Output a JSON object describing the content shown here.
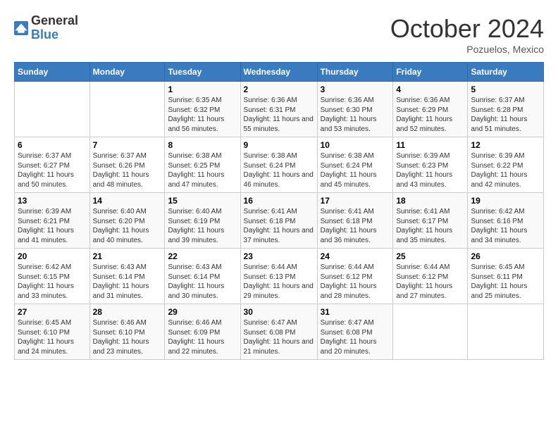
{
  "logo": {
    "general": "General",
    "blue": "Blue"
  },
  "header": {
    "month": "October 2024",
    "location": "Pozuelos, Mexico"
  },
  "days_of_week": [
    "Sunday",
    "Monday",
    "Tuesday",
    "Wednesday",
    "Thursday",
    "Friday",
    "Saturday"
  ],
  "weeks": [
    [
      {
        "day": "",
        "info": ""
      },
      {
        "day": "",
        "info": ""
      },
      {
        "day": "1",
        "sunrise": "6:35 AM",
        "sunset": "6:32 PM",
        "daylight": "11 hours and 56 minutes."
      },
      {
        "day": "2",
        "sunrise": "6:36 AM",
        "sunset": "6:31 PM",
        "daylight": "11 hours and 55 minutes."
      },
      {
        "day": "3",
        "sunrise": "6:36 AM",
        "sunset": "6:30 PM",
        "daylight": "11 hours and 53 minutes."
      },
      {
        "day": "4",
        "sunrise": "6:36 AM",
        "sunset": "6:29 PM",
        "daylight": "11 hours and 52 minutes."
      },
      {
        "day": "5",
        "sunrise": "6:37 AM",
        "sunset": "6:28 PM",
        "daylight": "11 hours and 51 minutes."
      }
    ],
    [
      {
        "day": "6",
        "sunrise": "6:37 AM",
        "sunset": "6:27 PM",
        "daylight": "11 hours and 50 minutes."
      },
      {
        "day": "7",
        "sunrise": "6:37 AM",
        "sunset": "6:26 PM",
        "daylight": "11 hours and 48 minutes."
      },
      {
        "day": "8",
        "sunrise": "6:38 AM",
        "sunset": "6:25 PM",
        "daylight": "11 hours and 47 minutes."
      },
      {
        "day": "9",
        "sunrise": "6:38 AM",
        "sunset": "6:24 PM",
        "daylight": "11 hours and 46 minutes."
      },
      {
        "day": "10",
        "sunrise": "6:38 AM",
        "sunset": "6:24 PM",
        "daylight": "11 hours and 45 minutes."
      },
      {
        "day": "11",
        "sunrise": "6:39 AM",
        "sunset": "6:23 PM",
        "daylight": "11 hours and 43 minutes."
      },
      {
        "day": "12",
        "sunrise": "6:39 AM",
        "sunset": "6:22 PM",
        "daylight": "11 hours and 42 minutes."
      }
    ],
    [
      {
        "day": "13",
        "sunrise": "6:39 AM",
        "sunset": "6:21 PM",
        "daylight": "11 hours and 41 minutes."
      },
      {
        "day": "14",
        "sunrise": "6:40 AM",
        "sunset": "6:20 PM",
        "daylight": "11 hours and 40 minutes."
      },
      {
        "day": "15",
        "sunrise": "6:40 AM",
        "sunset": "6:19 PM",
        "daylight": "11 hours and 39 minutes."
      },
      {
        "day": "16",
        "sunrise": "6:41 AM",
        "sunset": "6:18 PM",
        "daylight": "11 hours and 37 minutes."
      },
      {
        "day": "17",
        "sunrise": "6:41 AM",
        "sunset": "6:18 PM",
        "daylight": "11 hours and 36 minutes."
      },
      {
        "day": "18",
        "sunrise": "6:41 AM",
        "sunset": "6:17 PM",
        "daylight": "11 hours and 35 minutes."
      },
      {
        "day": "19",
        "sunrise": "6:42 AM",
        "sunset": "6:16 PM",
        "daylight": "11 hours and 34 minutes."
      }
    ],
    [
      {
        "day": "20",
        "sunrise": "6:42 AM",
        "sunset": "6:15 PM",
        "daylight": "11 hours and 33 minutes."
      },
      {
        "day": "21",
        "sunrise": "6:43 AM",
        "sunset": "6:14 PM",
        "daylight": "11 hours and 31 minutes."
      },
      {
        "day": "22",
        "sunrise": "6:43 AM",
        "sunset": "6:14 PM",
        "daylight": "11 hours and 30 minutes."
      },
      {
        "day": "23",
        "sunrise": "6:44 AM",
        "sunset": "6:13 PM",
        "daylight": "11 hours and 29 minutes."
      },
      {
        "day": "24",
        "sunrise": "6:44 AM",
        "sunset": "6:12 PM",
        "daylight": "11 hours and 28 minutes."
      },
      {
        "day": "25",
        "sunrise": "6:44 AM",
        "sunset": "6:12 PM",
        "daylight": "11 hours and 27 minutes."
      },
      {
        "day": "26",
        "sunrise": "6:45 AM",
        "sunset": "6:11 PM",
        "daylight": "11 hours and 25 minutes."
      }
    ],
    [
      {
        "day": "27",
        "sunrise": "6:45 AM",
        "sunset": "6:10 PM",
        "daylight": "11 hours and 24 minutes."
      },
      {
        "day": "28",
        "sunrise": "6:46 AM",
        "sunset": "6:10 PM",
        "daylight": "11 hours and 23 minutes."
      },
      {
        "day": "29",
        "sunrise": "6:46 AM",
        "sunset": "6:09 PM",
        "daylight": "11 hours and 22 minutes."
      },
      {
        "day": "30",
        "sunrise": "6:47 AM",
        "sunset": "6:08 PM",
        "daylight": "11 hours and 21 minutes."
      },
      {
        "day": "31",
        "sunrise": "6:47 AM",
        "sunset": "6:08 PM",
        "daylight": "11 hours and 20 minutes."
      },
      {
        "day": "",
        "info": ""
      },
      {
        "day": "",
        "info": ""
      }
    ]
  ],
  "labels": {
    "sunrise": "Sunrise:",
    "sunset": "Sunset:",
    "daylight": "Daylight:"
  }
}
